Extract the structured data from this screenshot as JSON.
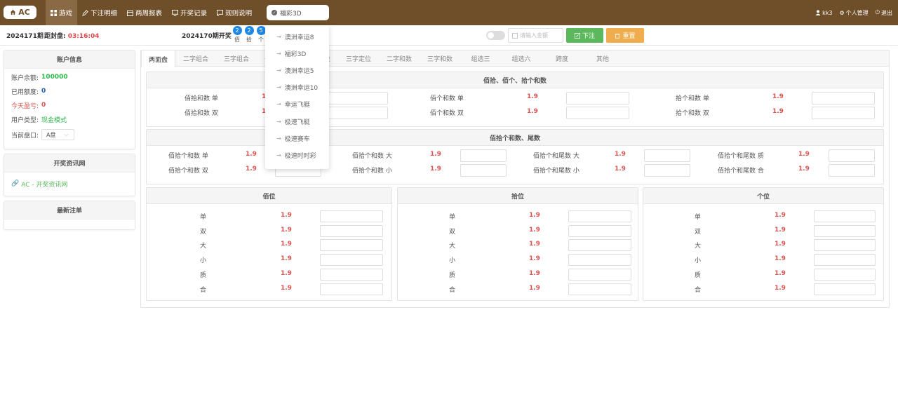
{
  "topbar": {
    "logo": "AC",
    "nav": [
      {
        "label": "游戏",
        "icon": "grid-icon"
      },
      {
        "label": "下注明细",
        "icon": "edit-icon"
      },
      {
        "label": "两周报表",
        "icon": "calendar-icon"
      },
      {
        "label": "开奖记录",
        "icon": "monitor-icon"
      },
      {
        "label": "规则说明",
        "icon": "message-icon"
      }
    ],
    "lottery_selected": "福彩3D",
    "user": {
      "name": "kk3",
      "account": "个人管理",
      "logout": "退出"
    }
  },
  "infobar": {
    "period": "2024171期",
    "countdown_label": "距封盘:",
    "countdown": "03:16:04",
    "prev_period": "2024170期开奖",
    "balls": [
      {
        "num": "2",
        "label": "佰"
      },
      {
        "num": "2",
        "label": "拾"
      },
      {
        "num": "5",
        "label": "个"
      }
    ],
    "amount_placeholder": "请输入金额",
    "bet_label": "下注",
    "reset_label": "重置"
  },
  "sidebar": {
    "account_title": "账户信息",
    "account_rows": [
      {
        "label": "账户余额:",
        "value": "100000",
        "color": "#2db84d"
      },
      {
        "label": "已用额度:",
        "value": "0",
        "color": "#1e5fb4"
      },
      {
        "label": "今天盈亏:",
        "value": "0",
        "color": "#d9534f"
      },
      {
        "label": "用户类型:",
        "value": "现金模式",
        "color": "#2db84d"
      }
    ],
    "market_label": "当前盘口:",
    "market_value": "A盘",
    "news_title": "开奖资讯网",
    "news_link": "AC - 开奖资讯网",
    "latest_title": "最新注单"
  },
  "tabs": [
    "两面盘",
    "二字组合",
    "三字组合",
    "一字组合",
    "二字定位",
    "三字定位",
    "二字和数",
    "三字和数",
    "组选三",
    "组选六",
    "跨度",
    "其他"
  ],
  "dropdown": [
    "澳洲幸运8",
    "福彩3D",
    "澳洲幸运5",
    "澳洲幸运10",
    "幸运飞艇",
    "极速飞艇",
    "极速赛车",
    "极速时时彩"
  ],
  "panel1": {
    "title": "佰拾、佰个、拾个和数",
    "rows": [
      [
        "佰拾和数 单",
        "1.9",
        "佰个和数 单",
        "1.9",
        "拾个和数 单",
        "1.9"
      ],
      [
        "佰拾和数 双",
        "1.9",
        "佰个和数 双",
        "1.9",
        "拾个和数 双",
        "1.9"
      ]
    ]
  },
  "panel2": {
    "title": "佰拾个和数、尾数",
    "rows": [
      [
        "佰拾个和数 单",
        "1.9",
        "佰拾个和数 大",
        "1.9",
        "佰拾个和尾数 大",
        "1.9",
        "佰拾个和尾数 质",
        "1.9"
      ],
      [
        "佰拾个和数 双",
        "1.9",
        "佰拾个和数 小",
        "1.9",
        "佰拾个和尾数 小",
        "1.9",
        "佰拾个和尾数 合",
        "1.9"
      ]
    ]
  },
  "positions": [
    {
      "title": "佰位",
      "rows": [
        [
          "单",
          "1.9"
        ],
        [
          "双",
          "1.9"
        ],
        [
          "大",
          "1.9"
        ],
        [
          "小",
          "1.9"
        ],
        [
          "质",
          "1.9"
        ],
        [
          "合",
          "1.9"
        ]
      ]
    },
    {
      "title": "拾位",
      "rows": [
        [
          "单",
          "1.9"
        ],
        [
          "双",
          "1.9"
        ],
        [
          "大",
          "1.9"
        ],
        [
          "小",
          "1.9"
        ],
        [
          "质",
          "1.9"
        ],
        [
          "合",
          "1.9"
        ]
      ]
    },
    {
      "title": "个位",
      "rows": [
        [
          "单",
          "1.9"
        ],
        [
          "双",
          "1.9"
        ],
        [
          "大",
          "1.9"
        ],
        [
          "小",
          "1.9"
        ],
        [
          "质",
          "1.9"
        ],
        [
          "合",
          "1.9"
        ]
      ]
    }
  ]
}
